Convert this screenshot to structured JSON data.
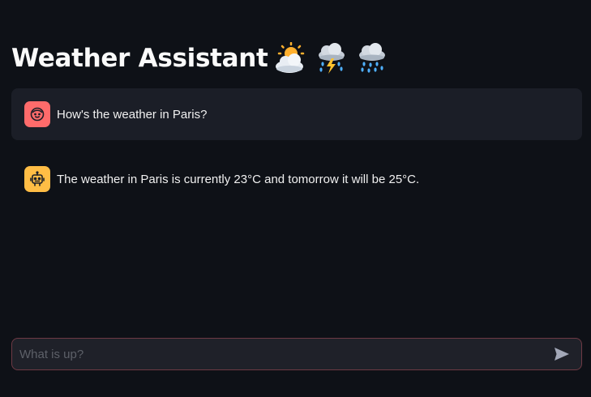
{
  "header": {
    "title": "Weather Assistant",
    "emojis": [
      "sun-behind-cloud-icon",
      "cloud-with-lightning-and-rain-icon",
      "cloud-with-rain-icon"
    ]
  },
  "messages": [
    {
      "role": "user",
      "avatar": "user-face-icon",
      "text": "How's the weather in Paris?"
    },
    {
      "role": "assistant",
      "avatar": "robot-icon",
      "text": "The weather in Paris is currently 23°C and tomorrow it will be 25°C."
    }
  ],
  "chat_input": {
    "placeholder": "What is up?",
    "value": "",
    "send_icon": "send-icon"
  },
  "colors": {
    "background": "#0e1117",
    "user_message_bg": "#1b1e27",
    "user_avatar": "#ff6b6b",
    "assistant_avatar": "#ffbd45",
    "input_border": "#6e3a44"
  }
}
